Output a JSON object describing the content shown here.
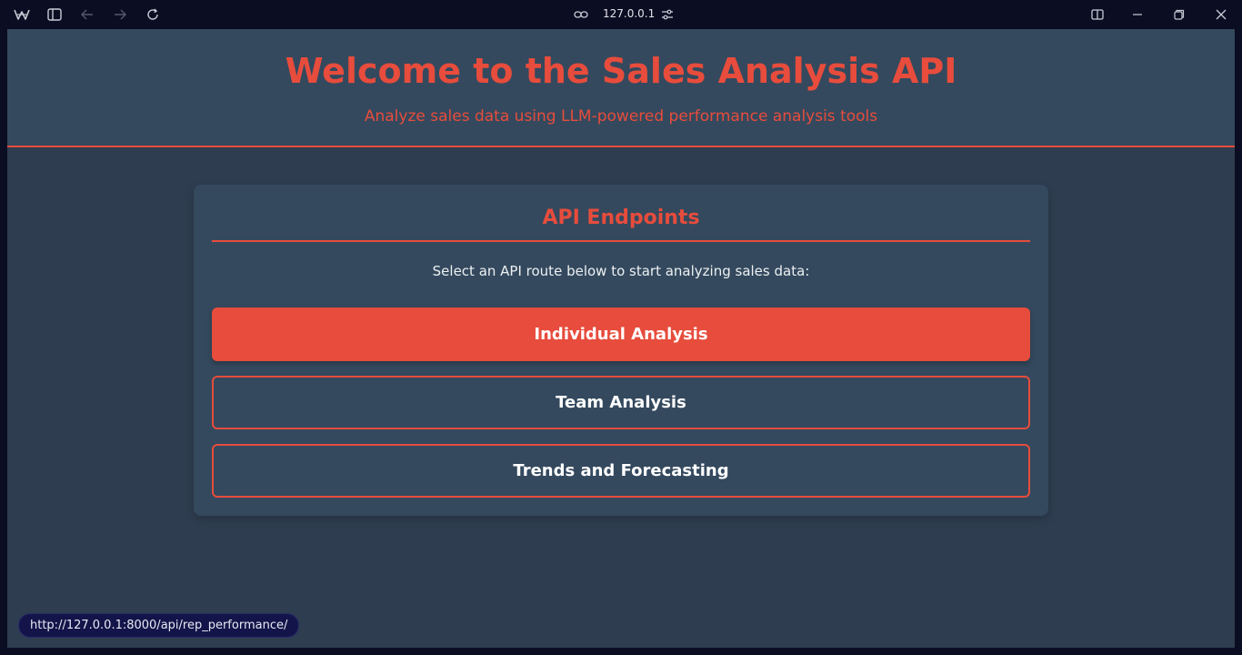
{
  "browser": {
    "url": "127.0.0.1",
    "icons": [
      "app-logo-icon",
      "sidebar-toggle-icon",
      "back-arrow-icon",
      "forward-arrow-icon",
      "reload-icon",
      "link-icon",
      "site-settings-icon",
      "split-view-icon",
      "minimize-icon",
      "restore-icon",
      "close-icon"
    ]
  },
  "hero": {
    "title": "Welcome to the Sales Analysis API",
    "subtitle": "Analyze sales data using LLM-powered performance analysis tools"
  },
  "endpoints": {
    "heading": "API Endpoints",
    "lead": "Select an API route below to start analyzing sales data:",
    "buttons": [
      {
        "label": "Individual Analysis"
      },
      {
        "label": "Team Analysis"
      },
      {
        "label": "Trends and Forecasting"
      }
    ]
  },
  "status_bar": {
    "link_preview": "http://127.0.0.1:8000/api/rep_performance/"
  },
  "colors": {
    "accent": "#e74c3c",
    "panel": "#34495e",
    "background": "#2e3d50",
    "chrome": "#0b0d22"
  }
}
